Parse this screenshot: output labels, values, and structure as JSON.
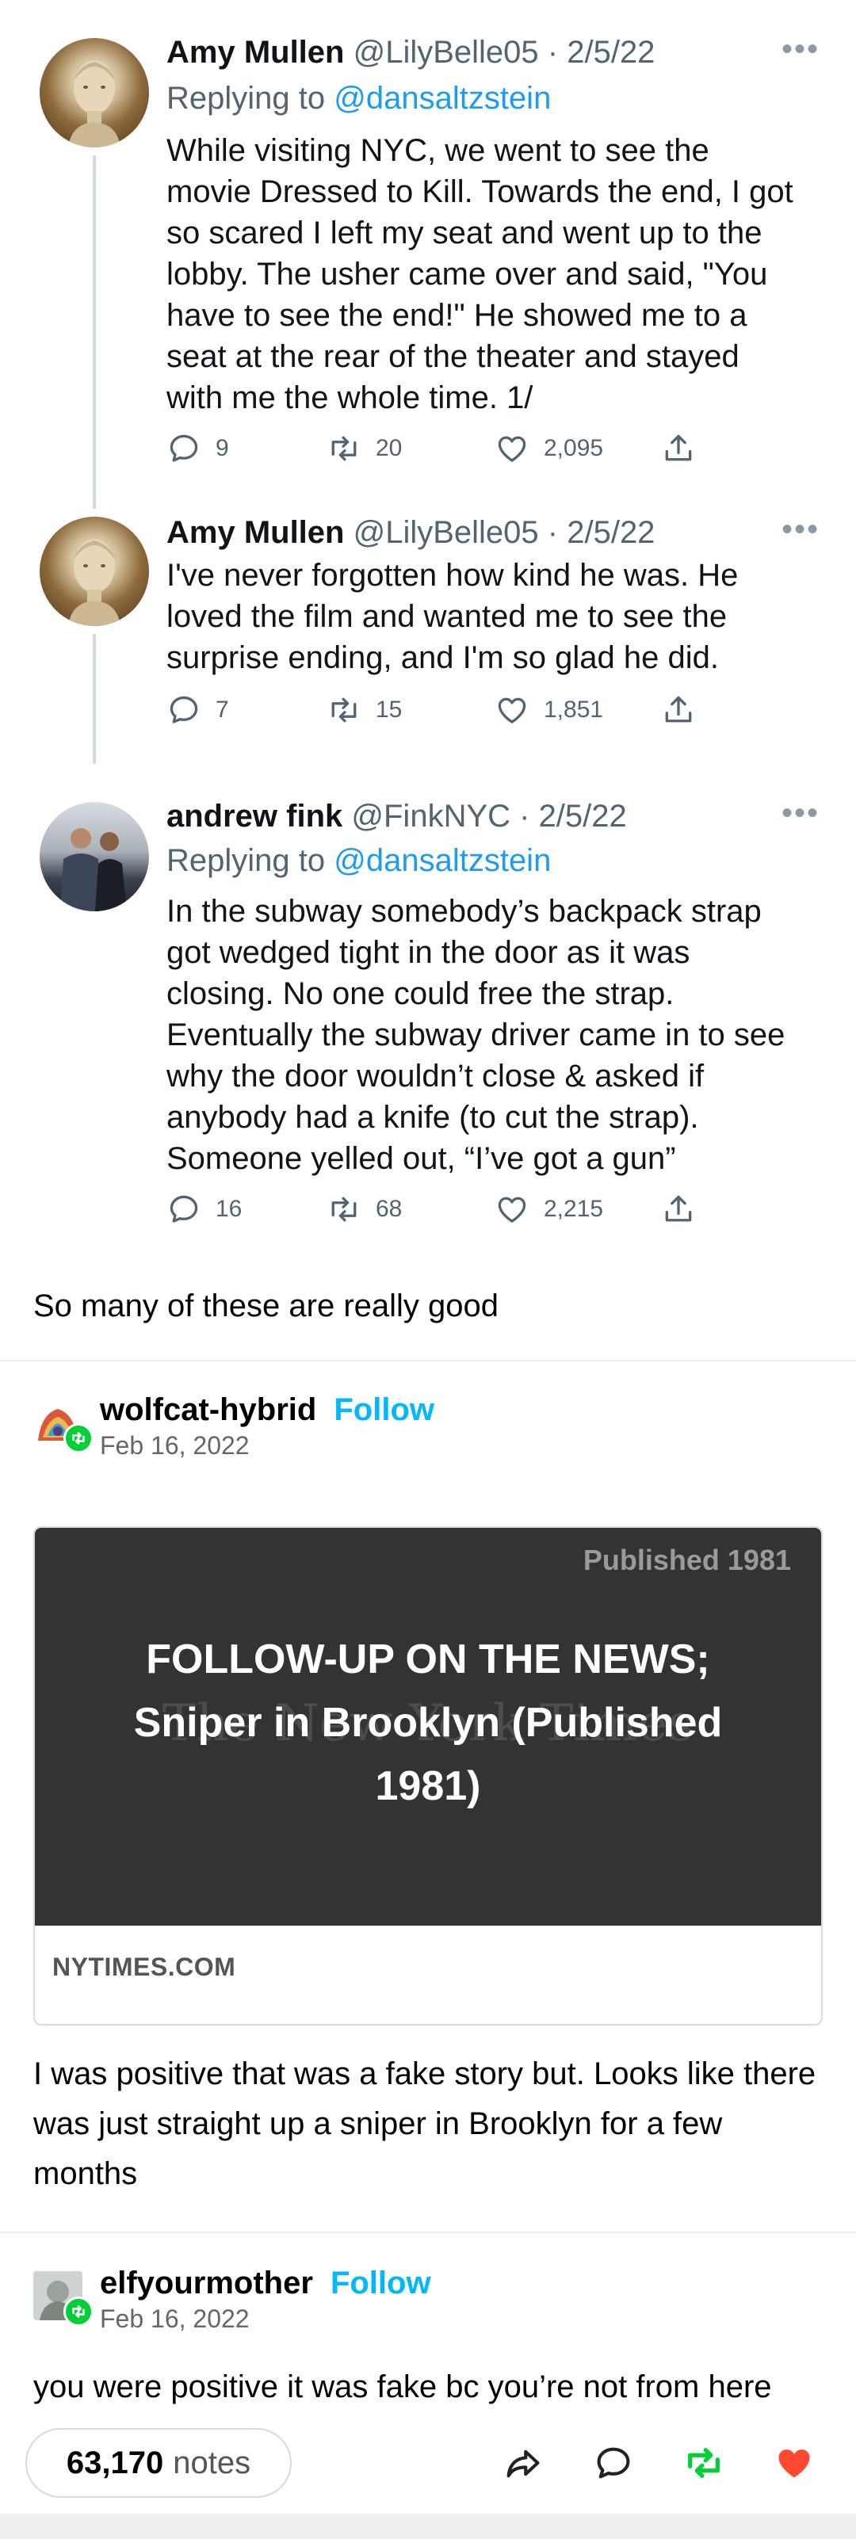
{
  "tweets": [
    {
      "name": "Amy Mullen",
      "handle": "@LilyBelle05",
      "sep": " · ",
      "date": "2/5/22",
      "reply_prefix": "Replying to ",
      "reply_to": "@dansaltzstein",
      "text": "While visiting NYC, we went to see the\nmovie Dressed to Kill. Towards the end, I got\nso scared I left my seat and went up to the\nlobby. The usher came over and said, \"You\nhave to see the end!\" He showed me to a\nseat at the rear of the theater and stayed\nwith me the whole time. 1/",
      "replies": "9",
      "retweets": "20",
      "likes": "2,095"
    },
    {
      "name": "Amy Mullen",
      "handle": "@LilyBelle05",
      "sep": " · ",
      "date": "2/5/22",
      "text": "I've never forgotten how kind he was. He\nloved the film and wanted me to see the\nsurprise ending, and I'm so glad he did.",
      "replies": "7",
      "retweets": "15",
      "likes": "1,851"
    },
    {
      "name": "andrew fink",
      "handle": "@FinkNYC",
      "sep": " · ",
      "date": "2/5/22",
      "reply_prefix": "Replying to ",
      "reply_to": "@dansaltzstein",
      "text": "In the subway somebody’s backpack strap\ngot wedged tight in the door as it was\nclosing. No one could free the strap.\nEventually the subway driver came in to see\nwhy the door wouldn’t close & asked if\nanybody had a knife (to cut the strap).\nSomeone yelled out, “I’ve got a gun”",
      "replies": "16",
      "retweets": "68",
      "likes": "2,215"
    }
  ],
  "caption_1": "So many of these are really good",
  "reblog_1": {
    "name": "wolfcat-hybrid",
    "follow": "Follow",
    "date": "Feb 16, 2022"
  },
  "link_card": {
    "published": "Published 1981",
    "watermark": "The New York Times",
    "title": "FOLLOW-UP ON THE NEWS; Sniper in Brooklyn (Published 1981)",
    "domain": "NYTIMES.COM"
  },
  "caption_2": "I was positive that was a fake story but. Looks like there was just straight up a sniper in Brooklyn for a few months",
  "reblog_2": {
    "name": "elfyourmother",
    "follow": "Follow",
    "date": "Feb 16, 2022"
  },
  "caption_3": "you were positive it was fake bc you’re not from here",
  "footer": {
    "notes_count": "63,170",
    "notes_label": "notes"
  },
  "colors": {
    "link_blue": "#1d9bf0",
    "follow_blue": "#00b8ff",
    "reblog_green": "#00cf35",
    "like_red": "#ff4930",
    "card_bg": "#333333"
  },
  "icons": [
    "more-icon",
    "reply-icon",
    "retweet-icon",
    "like-icon",
    "share-icon",
    "reblog-badge-icon",
    "share-arrow-icon",
    "comment-icon",
    "reblog-icon",
    "heart-icon"
  ]
}
